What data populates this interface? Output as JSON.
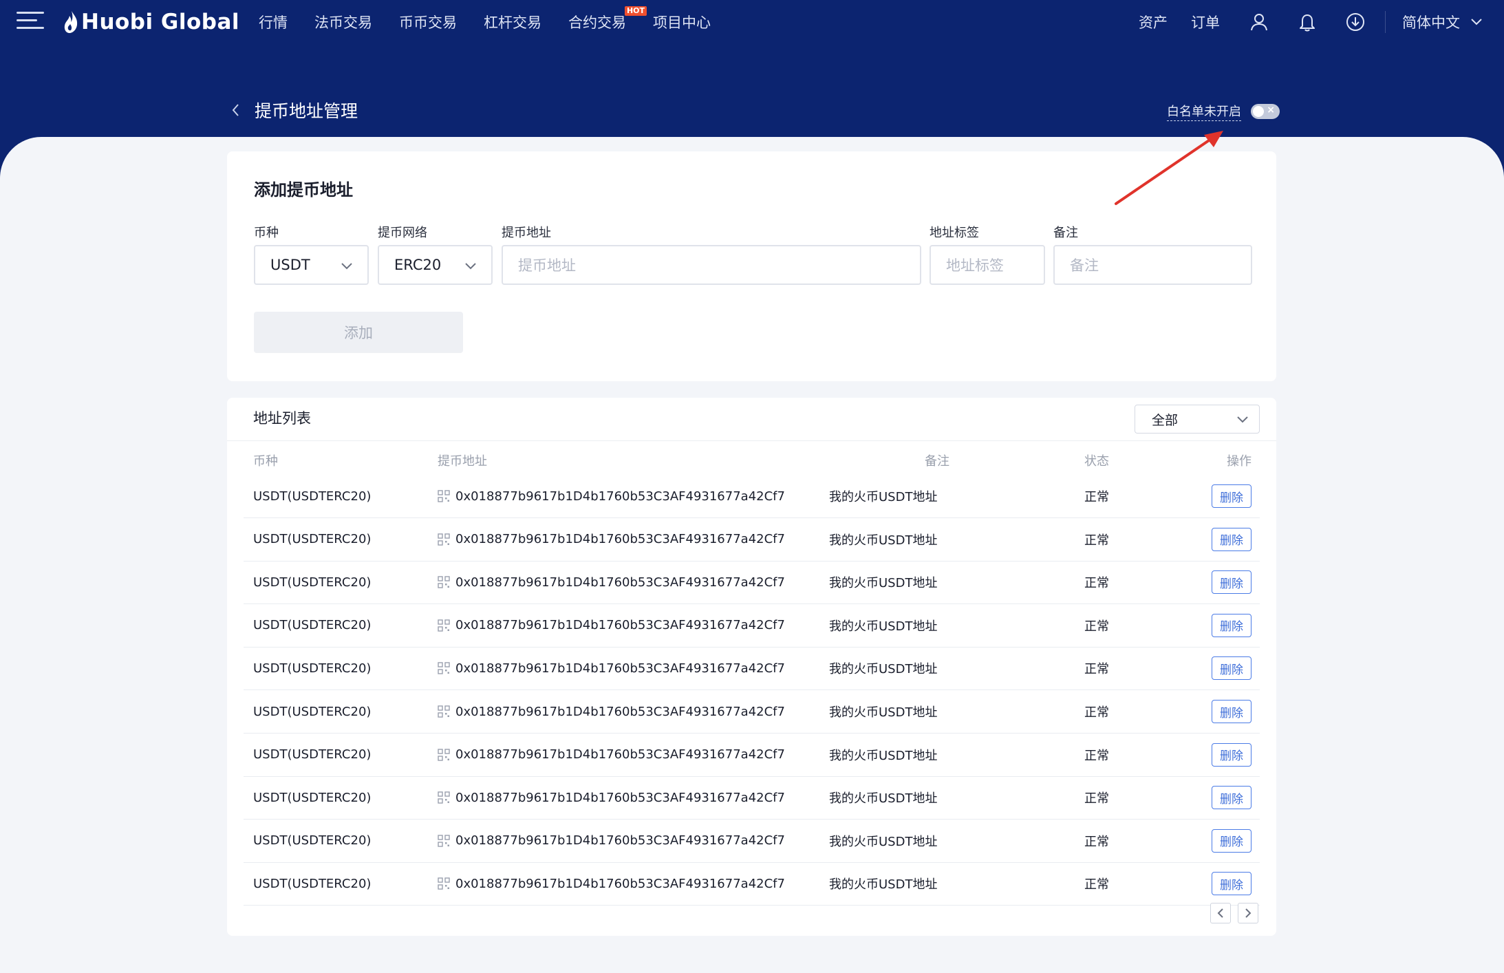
{
  "brand": {
    "logo_text": "Huobi Global",
    "header_color": "#0c2470",
    "accent": "#3f6fd9",
    "hot_badge_color": "#f0502f"
  },
  "nav": {
    "links": [
      {
        "label": "行情"
      },
      {
        "label": "法币交易"
      },
      {
        "label": "币币交易"
      },
      {
        "label": "杠杆交易"
      },
      {
        "label": "合约交易",
        "badge": "HOT"
      },
      {
        "label": "项目中心"
      }
    ],
    "assets": "资产",
    "orders": "订单",
    "language": "简体中文",
    "icons": [
      "user-icon",
      "bell-icon",
      "download-icon",
      "chevron-down-icon"
    ]
  },
  "page": {
    "title": "提币地址管理",
    "whitelist_label": "白名单未开启",
    "whitelist_enabled": false
  },
  "add_form": {
    "title": "添加提币地址",
    "currency": {
      "label": "币种",
      "value": "USDT"
    },
    "network": {
      "label": "提币网络",
      "value": "ERC20"
    },
    "address": {
      "label": "提币地址",
      "placeholder": "提币地址"
    },
    "tag": {
      "label": "地址标签",
      "placeholder": "地址标签"
    },
    "note": {
      "label": "备注",
      "placeholder": "备注"
    },
    "submit_label": "添加"
  },
  "address_list": {
    "title": "地址列表",
    "filter_value": "全部",
    "columns": {
      "currency": "币种",
      "address": "提币地址",
      "note": "备注",
      "status": "状态",
      "action": "操作"
    },
    "rows": [
      {
        "currency": "USDT(USDTERC20)",
        "address": "0x018877b9617b1D4b1760b53C3AF4931677a42Cf7",
        "note": "我的火币USDT地址",
        "status": "正常",
        "action": "删除"
      },
      {
        "currency": "USDT(USDTERC20)",
        "address": "0x018877b9617b1D4b1760b53C3AF4931677a42Cf7",
        "note": "我的火币USDT地址",
        "status": "正常",
        "action": "删除"
      },
      {
        "currency": "USDT(USDTERC20)",
        "address": "0x018877b9617b1D4b1760b53C3AF4931677a42Cf7",
        "note": "我的火币USDT地址",
        "status": "正常",
        "action": "删除"
      },
      {
        "currency": "USDT(USDTERC20)",
        "address": "0x018877b9617b1D4b1760b53C3AF4931677a42Cf7",
        "note": "我的火币USDT地址",
        "status": "正常",
        "action": "删除"
      },
      {
        "currency": "USDT(USDTERC20)",
        "address": "0x018877b9617b1D4b1760b53C3AF4931677a42Cf7",
        "note": "我的火币USDT地址",
        "status": "正常",
        "action": "删除"
      },
      {
        "currency": "USDT(USDTERC20)",
        "address": "0x018877b9617b1D4b1760b53C3AF4931677a42Cf7",
        "note": "我的火币USDT地址",
        "status": "正常",
        "action": "删除"
      },
      {
        "currency": "USDT(USDTERC20)",
        "address": "0x018877b9617b1D4b1760b53C3AF4931677a42Cf7",
        "note": "我的火币USDT地址",
        "status": "正常",
        "action": "删除"
      },
      {
        "currency": "USDT(USDTERC20)",
        "address": "0x018877b9617b1D4b1760b53C3AF4931677a42Cf7",
        "note": "我的火币USDT地址",
        "status": "正常",
        "action": "删除"
      },
      {
        "currency": "USDT(USDTERC20)",
        "address": "0x018877b9617b1D4b1760b53C3AF4931677a42Cf7",
        "note": "我的火币USDT地址",
        "status": "正常",
        "action": "删除"
      },
      {
        "currency": "USDT(USDTERC20)",
        "address": "0x018877b9617b1D4b1760b53C3AF4931677a42Cf7",
        "note": "我的火币USDT地址",
        "status": "正常",
        "action": "删除"
      }
    ]
  },
  "annotation": {
    "arrow_color": "#e0332b"
  }
}
